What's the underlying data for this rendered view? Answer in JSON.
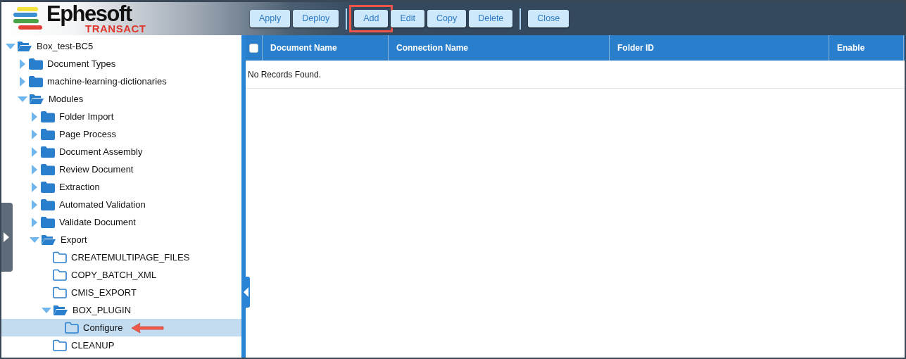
{
  "logo": {
    "name": "Ephesoft",
    "sub": "TRANSACT"
  },
  "toolbar": [
    [
      {
        "label": "Apply",
        "highlighted": false
      },
      {
        "label": "Deploy",
        "highlighted": false
      }
    ],
    [
      {
        "label": "Add",
        "highlighted": true
      },
      {
        "label": "Edit",
        "highlighted": false
      },
      {
        "label": "Copy",
        "highlighted": false
      },
      {
        "label": "Delete",
        "highlighted": false
      }
    ],
    [
      {
        "label": "Close",
        "highlighted": false
      }
    ]
  ],
  "tree": [
    {
      "label": "Box_test-BC5",
      "kind": "branch",
      "expanded": true,
      "selected": false,
      "children": [
        {
          "label": "Document Types",
          "kind": "branch",
          "expanded": false,
          "selected": false
        },
        {
          "label": "machine-learning-dictionaries",
          "kind": "branch",
          "expanded": false,
          "selected": false
        },
        {
          "label": "Modules",
          "kind": "branch",
          "expanded": true,
          "selected": false,
          "children": [
            {
              "label": "Folder Import",
              "kind": "branch",
              "expanded": false,
              "selected": false
            },
            {
              "label": "Page Process",
              "kind": "branch",
              "expanded": false,
              "selected": false
            },
            {
              "label": "Document Assembly",
              "kind": "branch",
              "expanded": false,
              "selected": false
            },
            {
              "label": "Review Document",
              "kind": "branch",
              "expanded": false,
              "selected": false
            },
            {
              "label": "Extraction",
              "kind": "branch",
              "expanded": false,
              "selected": false
            },
            {
              "label": "Automated Validation",
              "kind": "branch",
              "expanded": false,
              "selected": false
            },
            {
              "label": "Validate Document",
              "kind": "branch",
              "expanded": false,
              "selected": false
            },
            {
              "label": "Export",
              "kind": "branch",
              "expanded": true,
              "selected": false,
              "children": [
                {
                  "label": "CREATEMULTIPAGE_FILES",
                  "kind": "leaf",
                  "selected": false
                },
                {
                  "label": "COPY_BATCH_XML",
                  "kind": "leaf",
                  "selected": false
                },
                {
                  "label": "CMIS_EXPORT",
                  "kind": "leaf",
                  "selected": false
                },
                {
                  "label": "BOX_PLUGIN",
                  "kind": "branch",
                  "expanded": true,
                  "selected": false,
                  "children": [
                    {
                      "label": "Configure",
                      "kind": "leaf",
                      "selected": true,
                      "pointer": true
                    }
                  ]
                },
                {
                  "label": "CLEANUP",
                  "kind": "leaf",
                  "selected": false
                }
              ]
            }
          ]
        }
      ]
    }
  ],
  "table": {
    "select_all_checked": false,
    "columns": [
      "Document Name",
      "Connection Name",
      "Folder ID",
      "Enable"
    ],
    "empty_message": "No Records Found."
  }
}
